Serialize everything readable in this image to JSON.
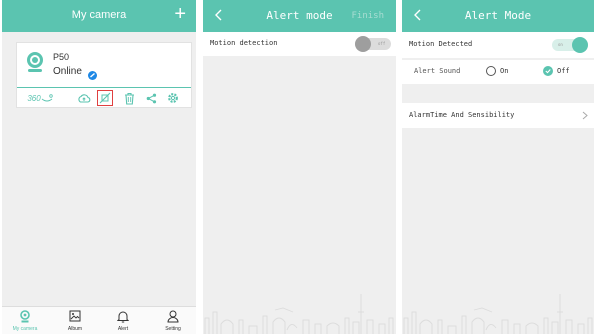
{
  "colors": {
    "accent": "#5bc4b0",
    "alarm_border": "#e04040",
    "status_blue": "#1e88e5"
  },
  "screen1": {
    "title": "My camera",
    "add_icon": "+",
    "camera": {
      "name": "P50",
      "status": "Online"
    },
    "tools": {
      "view360": "360"
    },
    "tabs": [
      {
        "label": "My camera",
        "icon": "camera-tab-icon",
        "active": true
      },
      {
        "label": "Album",
        "icon": "album-icon",
        "active": false
      },
      {
        "label": "Alert",
        "icon": "bell-icon",
        "active": false
      },
      {
        "label": "Setting",
        "icon": "user-icon",
        "active": false
      }
    ]
  },
  "screen2": {
    "title": "Alert mode",
    "finish": "Finish",
    "motion_label": "Motion detection",
    "toggle_text": "off"
  },
  "screen3": {
    "title": "Alert Mode",
    "motion_label": "Motion Detected",
    "toggle_text": "on",
    "sound_label": "Alert Sound",
    "sound_options": [
      {
        "label": "On",
        "selected": false
      },
      {
        "label": "Off",
        "selected": true
      }
    ],
    "alarm_time_label": "AlarmTime And Sensibility"
  }
}
